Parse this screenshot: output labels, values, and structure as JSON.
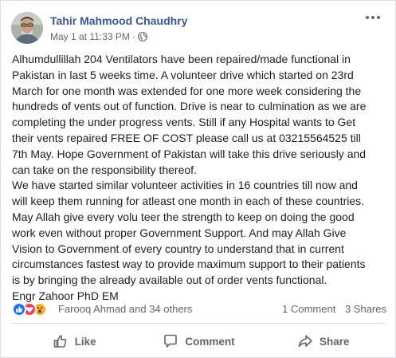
{
  "post": {
    "author": "Tahir Mahmood Chaudhry",
    "timestamp": "May 1 at 11:33 PM",
    "separator": "·",
    "privacy_icon": "globe-icon",
    "more_icon": "more-options-icon",
    "lines": [
      "Alhumdullillah 204 Ventilators have been repaired/made functional in",
      "Pakistan in last 5 weeks time. A volunteer drive which started on 23rd",
      "March for one month was extended for one more week considering the",
      "hundreds of vents out of function. Drive is near to culmination as we are",
      "completing the under progress vents. Still if any Hospital wants to Get",
      "their vents repaired FREE OF COST please call us at 03215564525 till",
      "7th May. Hope Government of Pakistan will take this drive seriously and",
      "can take on the responsibility thereof.",
      "We have started similar volunteer activities in 16 countries till now and",
      "will keep them running for atleast one month in each of these countries.",
      "May Allah give every volu teer the strength to keep on doing the good",
      "work even without proper Government Support. And may Allah Give",
      "Vision to Government of every country to understand that in current",
      "circumstances fastest way to provide maximum support to their patients",
      "is by bringing the already available out of order vents functional.",
      "Engr Zahoor PhD EM"
    ]
  },
  "reactions": {
    "icons": [
      "like-reaction-icon",
      "love-reaction-icon",
      "wow-reaction-icon"
    ],
    "names": "Farooq Ahmad and 34 others",
    "comments": "1 Comment",
    "shares": "3 Shares"
  },
  "actions": {
    "like": "Like",
    "comment": "Comment",
    "share": "Share"
  },
  "colors": {
    "author_link": "#385898",
    "meta_text": "#606770",
    "like_blue": "#1877f2",
    "love_red": "#f33e58",
    "wow_yellow": "#f7b125"
  }
}
